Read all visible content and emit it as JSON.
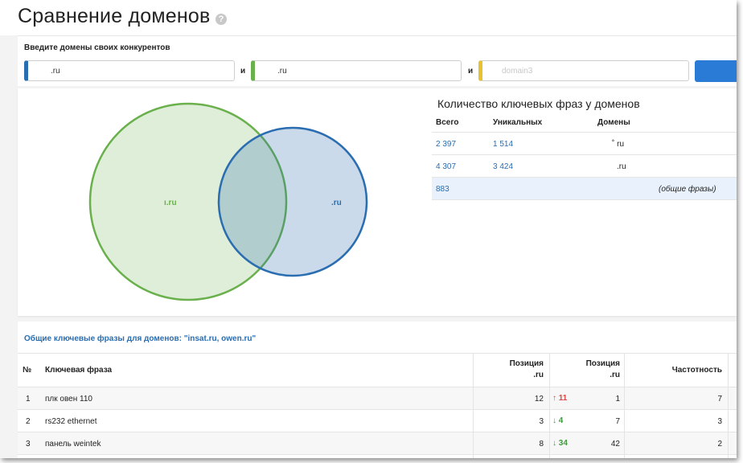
{
  "page": {
    "title": "Сравнение доменов",
    "help_icon": "?"
  },
  "competitors": {
    "label": "Введите домены своих конкурентов",
    "domain1": {
      "value": ".ru",
      "color": "#2a6db0"
    },
    "separator1": "и",
    "domain2": {
      "value": ".ru",
      "color": "#6ab04c"
    },
    "separator2": "и",
    "domain3": {
      "placeholder": "domain3",
      "color": "#e6c22e"
    },
    "button_color": "#2a7bd5"
  },
  "venn": {
    "left_label": "ı.ru",
    "right_label": ".ru",
    "left_color": "#6ab04c",
    "right_color": "#2a6db0"
  },
  "stats": {
    "title": "Количество ключевых фраз у доменов",
    "headers": {
      "total": "Всего",
      "unique": "Уникальных",
      "domains": "Домены"
    },
    "rows": [
      {
        "total": "2 397",
        "unique": "1 514",
        "domain": "˚ ru"
      },
      {
        "total": "4 307",
        "unique": "3 424",
        "domain": ".ru"
      }
    ],
    "common": {
      "total": "883",
      "label": "(общие фразы)"
    }
  },
  "results": {
    "title": "Общие ключевые фразы для доменов: \"insat.ru, owen.ru\"",
    "headers": {
      "num": "№",
      "phrase": "Ключевая фраза",
      "pos1_line1": "Позиция",
      "pos1_line2": ".ru",
      "pos2_line1": "Позиция",
      "pos2_line2": ".ru",
      "freq": "Частотность"
    },
    "rows": [
      {
        "num": "1",
        "phrase": "плк овен 110",
        "pos1": "12",
        "arrow": "↑",
        "diff": "11",
        "trend": "up",
        "pos2": "1",
        "freq": "7"
      },
      {
        "num": "2",
        "phrase": "rs232 ethernet",
        "pos1": "3",
        "arrow": "↓",
        "diff": "4",
        "trend": "down",
        "pos2": "7",
        "freq": "3"
      },
      {
        "num": "3",
        "phrase": "панель weintek",
        "pos1": "8",
        "arrow": "↓",
        "diff": "34",
        "trend": "down",
        "pos2": "42",
        "freq": "2"
      }
    ]
  }
}
